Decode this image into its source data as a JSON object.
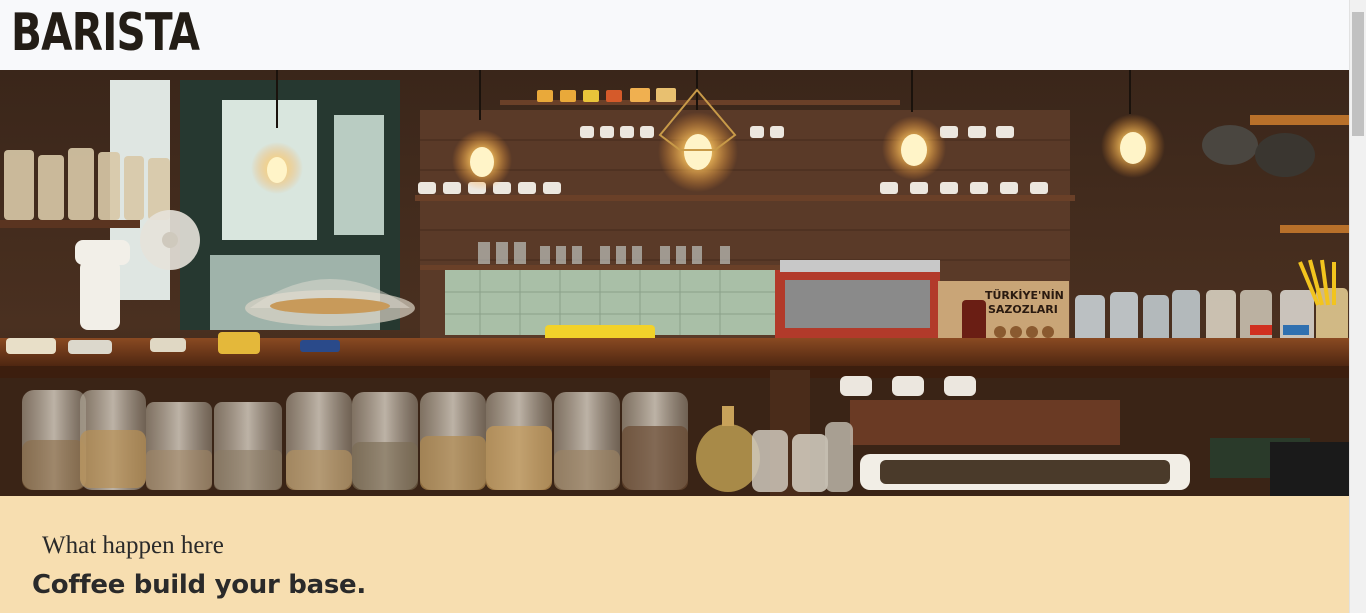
{
  "header": {
    "logo_text": "BARISTA"
  },
  "hero": {
    "sign_line1": "TÜRKİYE'NİN",
    "sign_line2": "SAZOZLARI"
  },
  "intro": {
    "eyebrow": "What happen here",
    "headline": "Coffee build your base."
  },
  "colors": {
    "section_bg": "#f7deb0",
    "header_bg": "#f8f9fb",
    "text": "#2a2a2a",
    "logo": "#231d16"
  }
}
